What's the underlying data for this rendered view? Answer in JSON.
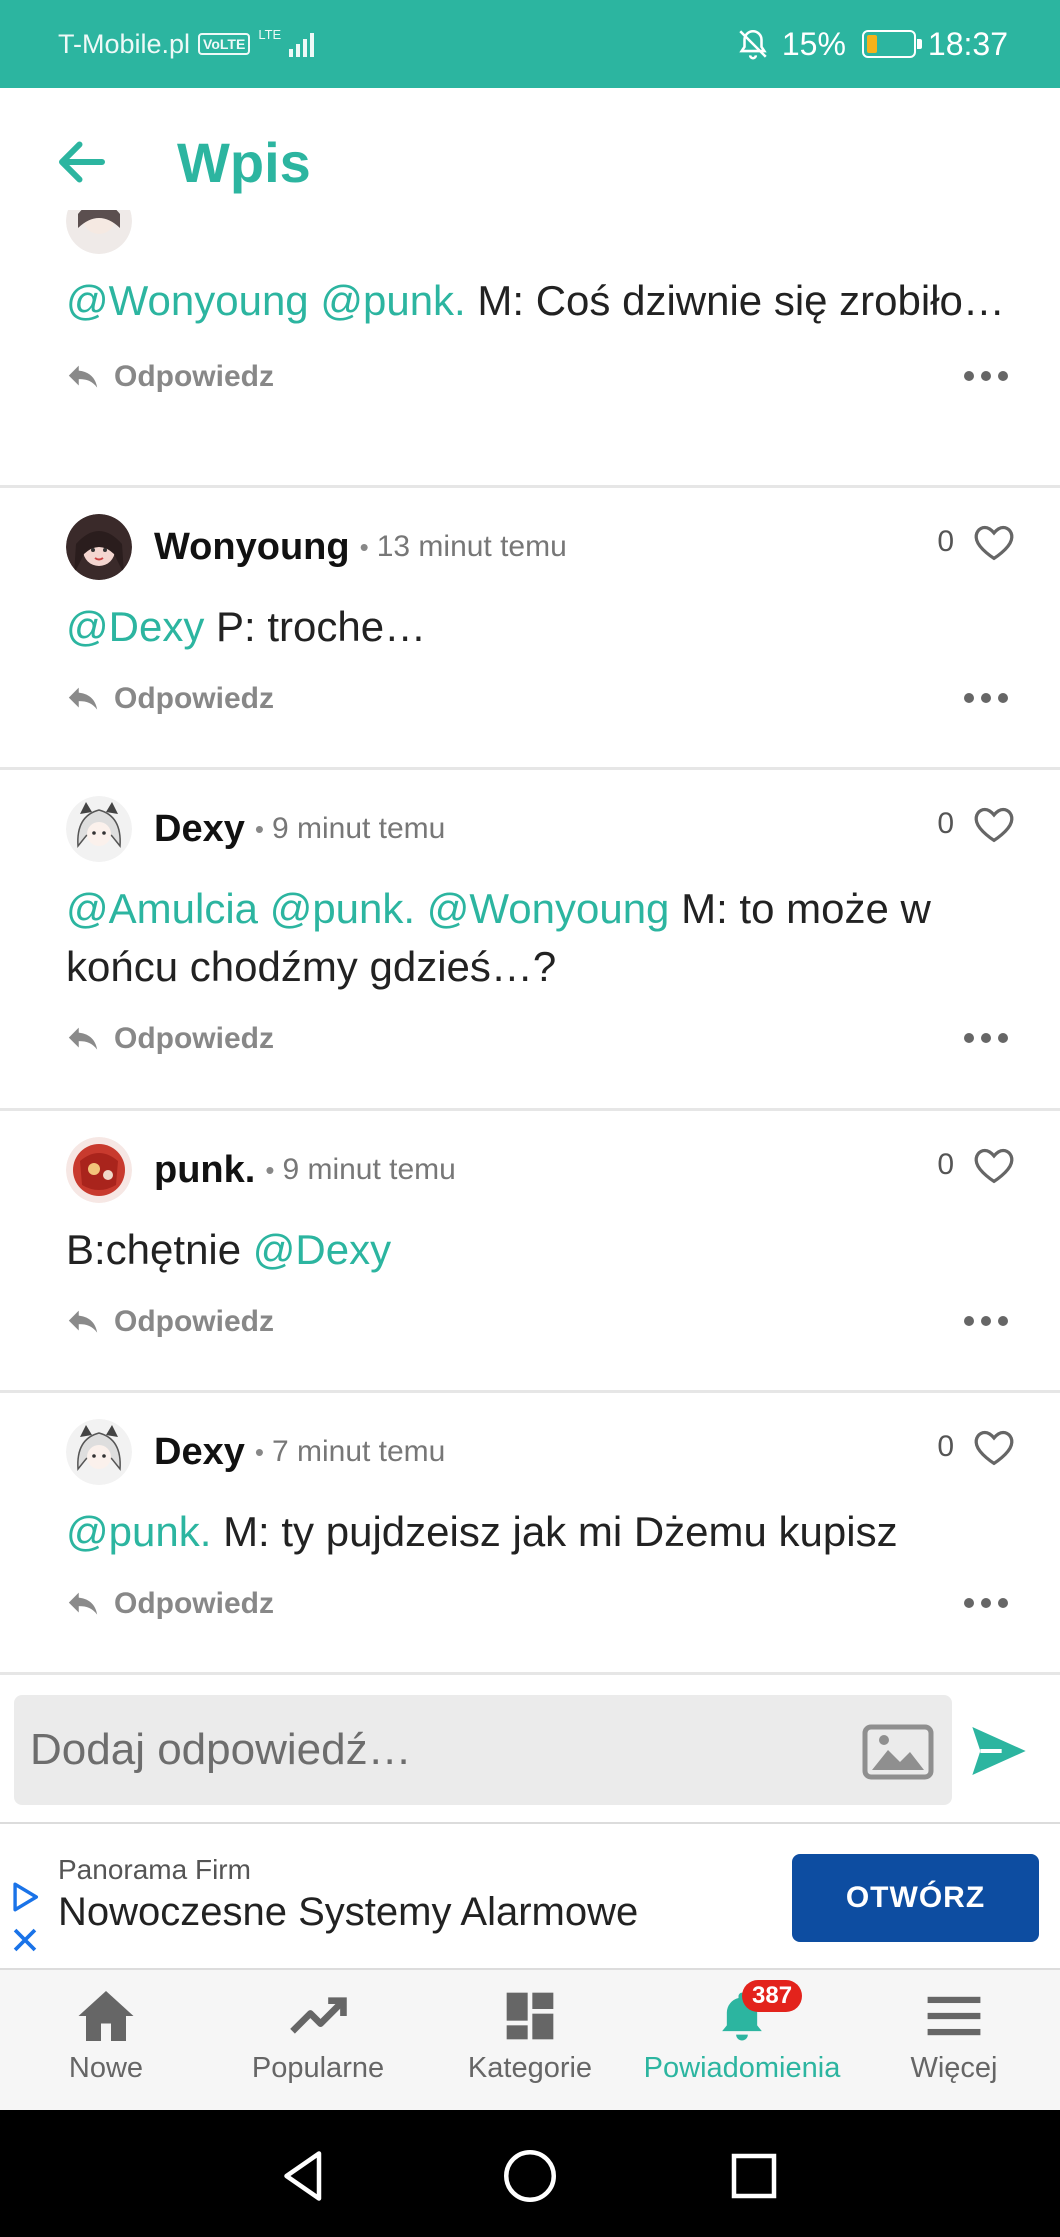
{
  "status_bar": {
    "carrier": "T-Mobile.pl",
    "volte": "VoLTE",
    "lte": "LTE",
    "battery_percent": "15%",
    "time": "18:37"
  },
  "header": {
    "title": "Wpis"
  },
  "posts": [
    {
      "author": "",
      "time": "",
      "likes": "",
      "mentions": [
        "@Wonyoung",
        "@punk."
      ],
      "text": "M: Coś dziwnie się zrobiło…",
      "reply_label": "Odpowiedz"
    },
    {
      "author": "Wonyoung",
      "time": "13 minut temu",
      "likes": "0",
      "mentions": [
        "@Dexy"
      ],
      "text": "P: troche…",
      "reply_label": "Odpowiedz"
    },
    {
      "author": "Dexy",
      "time": "9 minut temu",
      "likes": "0",
      "mentions": [
        "@Amulcia",
        "@punk.",
        "@Wonyoung"
      ],
      "text": "M: to może w końcu chodźmy gdzieś…?",
      "reply_label": "Odpowiedz"
    },
    {
      "author": "punk.",
      "time": "9 minut temu",
      "likes": "0",
      "prefix": "B:chętnie",
      "mentions": [
        "@Dexy"
      ],
      "reply_label": "Odpowiedz"
    },
    {
      "author": "Dexy",
      "time": "7 minut temu",
      "likes": "0",
      "mentions": [
        "@punk."
      ],
      "text": "M: ty pujdzeisz jak mi Dżemu kupisz",
      "reply_label": "Odpowiedz"
    }
  ],
  "composer": {
    "placeholder": "Dodaj odpowiedź…"
  },
  "ad": {
    "sponsor": "Panorama Firm",
    "title": "Nowoczesne Systemy Alarmowe",
    "cta": "OTWÓRZ"
  },
  "bottom_nav": {
    "items": [
      {
        "label": "Nowe",
        "icon": "home-icon"
      },
      {
        "label": "Popularne",
        "icon": "trending-icon"
      },
      {
        "label": "Kategorie",
        "icon": "categories-icon"
      },
      {
        "label": "Powiadomienia",
        "icon": "bell-icon",
        "badge": "387"
      },
      {
        "label": "Więcej",
        "icon": "menu-icon"
      }
    ]
  },
  "colors": {
    "accent": "#2cb5a0",
    "ad_button": "#0d4da1",
    "badge": "#e3231c"
  }
}
